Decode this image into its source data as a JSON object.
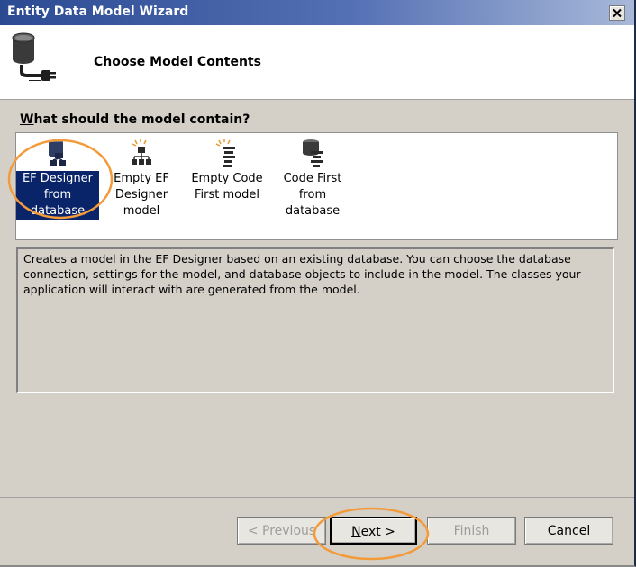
{
  "window": {
    "title": "Entity Data Model Wizard"
  },
  "header": {
    "title": "Choose Model Contents"
  },
  "question": {
    "prefix": "W",
    "rest": "hat should the model contain?"
  },
  "models": [
    {
      "label": "EF Designer from database",
      "icon": "database-designer-icon",
      "selected": true
    },
    {
      "label": "Empty EF Designer model",
      "icon": "empty-designer-icon",
      "selected": false
    },
    {
      "label": "Empty Code First model",
      "icon": "empty-code-first-icon",
      "selected": false
    },
    {
      "label": "Code First from database",
      "icon": "code-first-database-icon",
      "selected": false
    }
  ],
  "description": "Creates a model in the EF Designer based on an existing database. You can choose the database connection, settings for the model, and database objects to include in the model. The classes your application will interact with are generated from the model.",
  "buttons": {
    "previous": {
      "pre": "< ",
      "key": "P",
      "rest": "revious",
      "enabled": false
    },
    "next": {
      "key": "N",
      "rest": "ext >",
      "enabled": true
    },
    "finish": {
      "key": "F",
      "rest": "inish",
      "enabled": false
    },
    "cancel": {
      "label": "Cancel",
      "enabled": true
    }
  },
  "colors": {
    "highlight_circle": "#f39a3b",
    "selection": "#0a246a",
    "titlebar": "#2b4a92"
  }
}
